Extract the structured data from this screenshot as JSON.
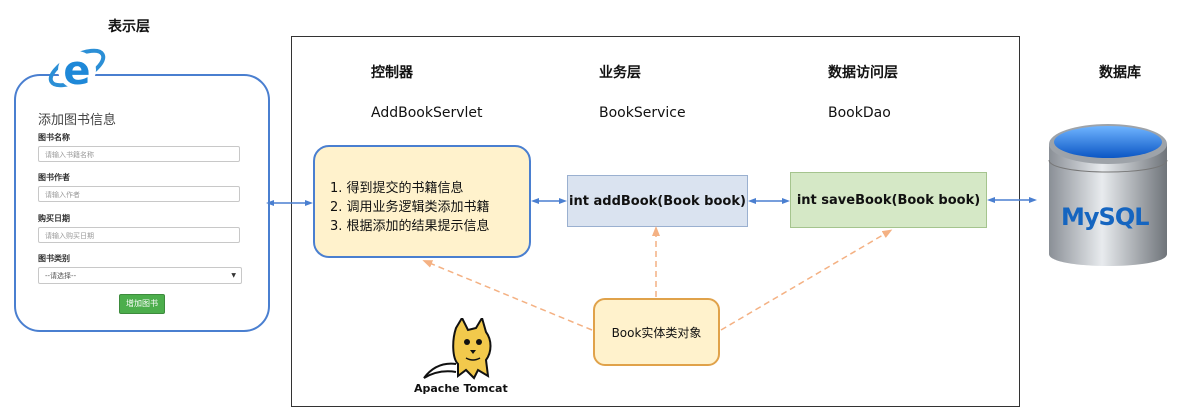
{
  "presentation": {
    "header": "表示层",
    "form": {
      "title": "添加图书信息",
      "fields": [
        {
          "label": "图书名称",
          "placeholder": "请输入书籍名称"
        },
        {
          "label": "图书作者",
          "placeholder": "请输入作者"
        },
        {
          "label": "购买日期",
          "placeholder": "请输入购买日期"
        }
      ],
      "category_label": "图书类别",
      "category_selected": "--请选择--",
      "submit_label": "增加图书"
    },
    "browser_icon": "ie-logo-icon"
  },
  "server": {
    "controller": {
      "header": "控制器",
      "name": "AddBookServlet",
      "steps": [
        "1. 得到提交的书籍信息",
        "2. 调用业务逻辑类添加书籍",
        "3. 根据添加的结果提示信息"
      ]
    },
    "service": {
      "header": "业务层",
      "name": "BookService",
      "method": "int addBook(Book book)"
    },
    "dao": {
      "header": "数据访问层",
      "name": "BookDao",
      "method": "int saveBook(Book book)"
    },
    "entity": "Book实体类对象",
    "container": "Apache Tomcat"
  },
  "database": {
    "header": "数据库",
    "logo": "MySQL"
  },
  "colors": {
    "arrow_blue": "#4a7fd0",
    "dashed_orange": "#f4b183",
    "controller_fill": "#fff2cc",
    "service_fill": "#dae3f0",
    "dao_fill": "#d5e8c6"
  }
}
